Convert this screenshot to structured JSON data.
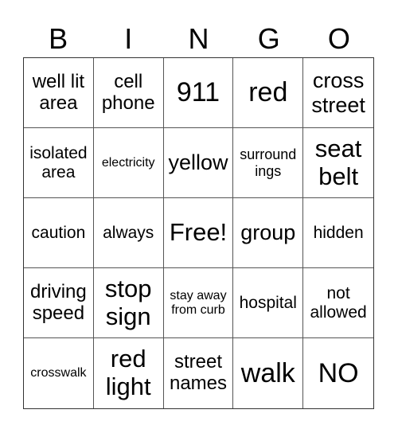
{
  "header": {
    "letters": [
      "B",
      "I",
      "N",
      "G",
      "O"
    ]
  },
  "cells": [
    "well lit area",
    "cell phone",
    "911",
    "red",
    "cross street",
    "isolated area",
    "electricity",
    "yellow",
    "surround ings",
    "seat belt",
    "caution",
    "always",
    "Free!",
    "group",
    "hidden",
    "driving speed",
    "stop sign",
    "stay away from curb",
    "hospital",
    "not allowed",
    "crosswalk",
    "red light",
    "street names",
    "walk",
    "NO"
  ]
}
